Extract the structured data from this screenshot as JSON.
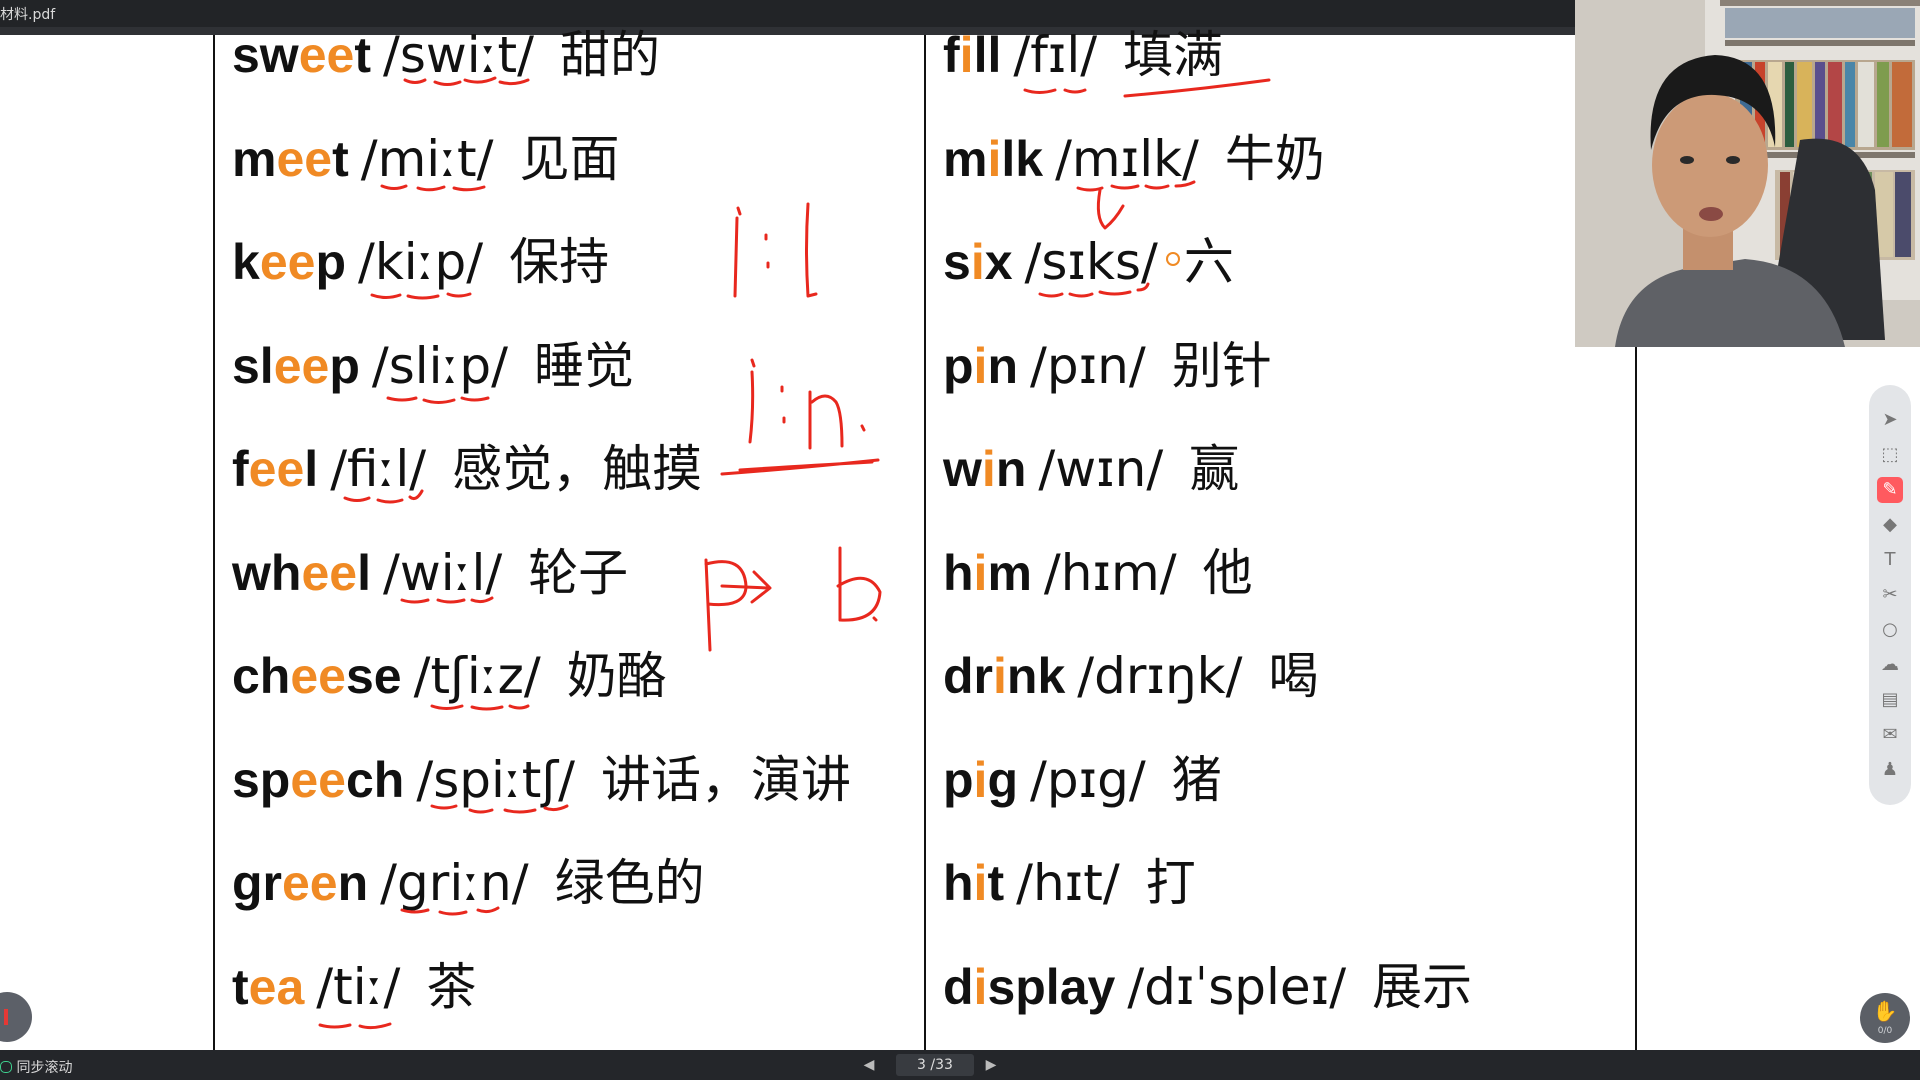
{
  "window": {
    "title": "材料.pdf"
  },
  "left_column": [
    {
      "parts": [
        {
          "t": "sw",
          "h": false
        },
        {
          "t": "ee",
          "h": true
        },
        {
          "t": "t",
          "h": false
        }
      ],
      "ipa": "/swiːt/",
      "meaning": "甜的"
    },
    {
      "parts": [
        {
          "t": "m",
          "h": false
        },
        {
          "t": "ee",
          "h": true
        },
        {
          "t": "t",
          "h": false
        }
      ],
      "ipa": "/miːt/",
      "meaning": "见面"
    },
    {
      "parts": [
        {
          "t": "k",
          "h": false
        },
        {
          "t": "ee",
          "h": true
        },
        {
          "t": "p",
          "h": false
        }
      ],
      "ipa": "/kiːp/",
      "meaning": "保持"
    },
    {
      "parts": [
        {
          "t": "sl",
          "h": false
        },
        {
          "t": "ee",
          "h": true
        },
        {
          "t": "p",
          "h": false
        }
      ],
      "ipa": "/sliːp/",
      "meaning": "睡觉"
    },
    {
      "parts": [
        {
          "t": "f",
          "h": false
        },
        {
          "t": "ee",
          "h": true
        },
        {
          "t": "l",
          "h": false
        }
      ],
      "ipa": "/fiːl/",
      "meaning": "感觉，触摸"
    },
    {
      "parts": [
        {
          "t": "wh",
          "h": false
        },
        {
          "t": "ee",
          "h": true
        },
        {
          "t": "l",
          "h": false
        }
      ],
      "ipa": "/wiːl/",
      "meaning": "轮子"
    },
    {
      "parts": [
        {
          "t": "ch",
          "h": false
        },
        {
          "t": "ee",
          "h": true
        },
        {
          "t": "se",
          "h": false
        }
      ],
      "ipa": "/tʃiːz/",
      "meaning": "奶酪"
    },
    {
      "parts": [
        {
          "t": "sp",
          "h": false
        },
        {
          "t": "ee",
          "h": true
        },
        {
          "t": "ch",
          "h": false
        }
      ],
      "ipa": "/spiːtʃ/",
      "meaning": "讲话，演讲"
    },
    {
      "parts": [
        {
          "t": "gr",
          "h": false
        },
        {
          "t": "ee",
          "h": true
        },
        {
          "t": "n",
          "h": false
        }
      ],
      "ipa": "/griːn/",
      "meaning": "绿色的"
    },
    {
      "parts": [
        {
          "t": "t",
          "h": false
        },
        {
          "t": "ea",
          "h": true
        }
      ],
      "ipa": "/tiː/",
      "meaning": "茶"
    }
  ],
  "right_column": [
    {
      "parts": [
        {
          "t": "f",
          "h": false
        },
        {
          "t": "i",
          "h": true
        },
        {
          "t": "ll",
          "h": false
        }
      ],
      "ipa": "/fɪl/",
      "meaning": "填满"
    },
    {
      "parts": [
        {
          "t": "m",
          "h": false
        },
        {
          "t": "i",
          "h": true
        },
        {
          "t": "lk",
          "h": false
        }
      ],
      "ipa": "/mɪlk/",
      "meaning": "牛奶"
    },
    {
      "parts": [
        {
          "t": "s",
          "h": false
        },
        {
          "t": "i",
          "h": true
        },
        {
          "t": "x",
          "h": false
        }
      ],
      "ipa": "/sɪks/",
      "meaning": "六"
    },
    {
      "parts": [
        {
          "t": "p",
          "h": false
        },
        {
          "t": "i",
          "h": true
        },
        {
          "t": "n",
          "h": false
        }
      ],
      "ipa": "/pɪn/",
      "meaning": "别针"
    },
    {
      "parts": [
        {
          "t": "w",
          "h": false
        },
        {
          "t": "i",
          "h": true
        },
        {
          "t": "n",
          "h": false
        }
      ],
      "ipa": "/wɪn/",
      "meaning": "赢"
    },
    {
      "parts": [
        {
          "t": "h",
          "h": false
        },
        {
          "t": "i",
          "h": true
        },
        {
          "t": "m",
          "h": false
        }
      ],
      "ipa": "/hɪm/",
      "meaning": "他"
    },
    {
      "parts": [
        {
          "t": "dr",
          "h": false
        },
        {
          "t": "i",
          "h": true
        },
        {
          "t": "nk",
          "h": false
        }
      ],
      "ipa": "/drɪŋk/",
      "meaning": "喝"
    },
    {
      "parts": [
        {
          "t": "p",
          "h": false
        },
        {
          "t": "i",
          "h": true
        },
        {
          "t": "g",
          "h": false
        }
      ],
      "ipa": "/pɪg/",
      "meaning": "猪"
    },
    {
      "parts": [
        {
          "t": "h",
          "h": false
        },
        {
          "t": "i",
          "h": true
        },
        {
          "t": "t",
          "h": false
        }
      ],
      "ipa": "/hɪt/",
      "meaning": "打"
    },
    {
      "parts": [
        {
          "t": "d",
          "h": false
        },
        {
          "t": "i",
          "h": true
        },
        {
          "t": "splay",
          "h": false
        }
      ],
      "ipa": "/dɪˈspleɪ/",
      "meaning": "展示"
    }
  ],
  "toolbar": {
    "tools": [
      {
        "name": "pointer-icon",
        "glyph": "➤"
      },
      {
        "name": "select-region-icon",
        "glyph": "⬚"
      },
      {
        "name": "pen-icon",
        "glyph": "✎"
      },
      {
        "name": "eraser-icon",
        "glyph": "◆"
      },
      {
        "name": "text-icon",
        "glyph": "T"
      },
      {
        "name": "scissors-icon",
        "glyph": "✂"
      },
      {
        "name": "shape-icon",
        "glyph": "○"
      },
      {
        "name": "cloud-icon",
        "glyph": "☁"
      },
      {
        "name": "box-icon",
        "glyph": "▤"
      },
      {
        "name": "chat-icon",
        "glyph": "✉"
      },
      {
        "name": "users-icon",
        "glyph": "♟"
      }
    ],
    "active_index": 2
  },
  "status": {
    "sync_scroll": "同步滚动",
    "page_indicator": "3 /33",
    "fab_count": "0/0"
  },
  "colors": {
    "highlight": "#f08a24",
    "annotation": "#e8281e"
  }
}
